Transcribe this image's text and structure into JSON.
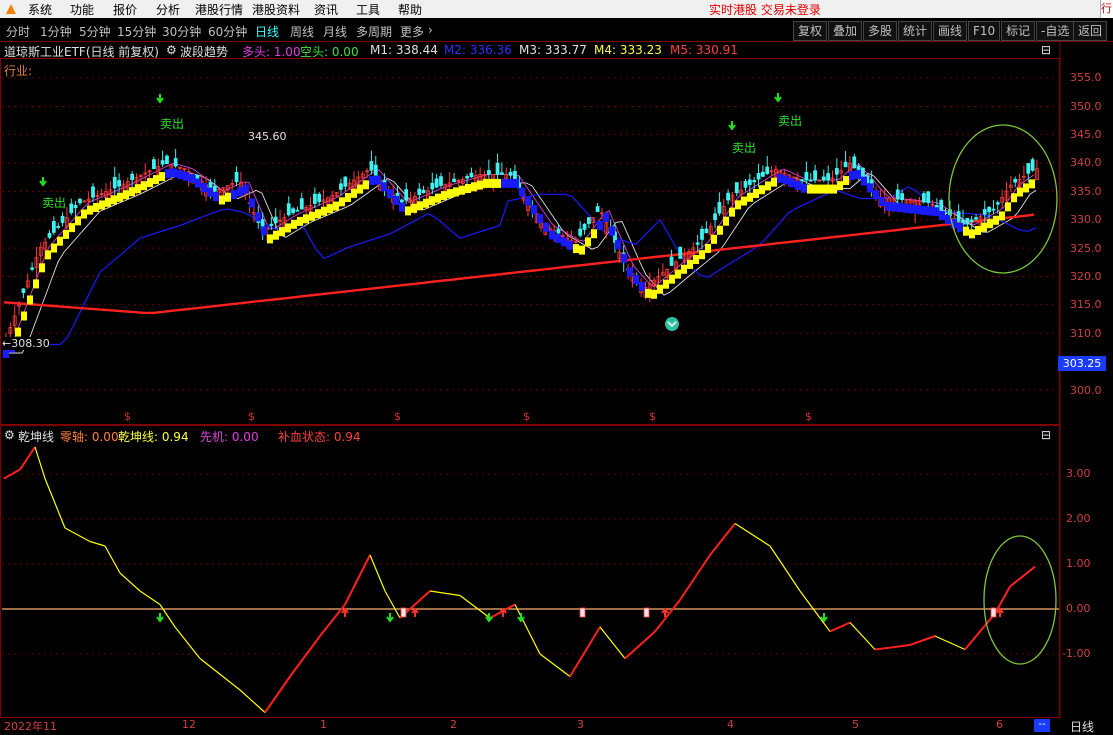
{
  "menu": {
    "items": [
      "系统",
      "功能",
      "报价",
      "分析",
      "港股行情",
      "港股资料",
      "资讯",
      "工具",
      "帮助"
    ],
    "status": "实时港股 交易未登录",
    "edge": "行"
  },
  "tabs": {
    "items": [
      "分时",
      "1分钟",
      "5分钟",
      "15分钟",
      "30分钟",
      "60分钟",
      "日线",
      "周线",
      "月线",
      "多周期",
      "更多"
    ],
    "active": "日线",
    "more_arrow": "›"
  },
  "right_buttons": [
    "复权",
    "叠加",
    "多股",
    "统计",
    "画线",
    "F10",
    "标记",
    "-自选",
    "返回"
  ],
  "info": {
    "title": "道琼斯工业ETF(日线 前复权)",
    "indicator": "波段趋势",
    "duotou": "多头: 1.00",
    "kongtou": "空头: 0.00",
    "m1": "M1: 338.44",
    "m2": "M2: 336.36",
    "m3": "M3: 333.77",
    "m4": "M4: 333.23",
    "m5": "M5: 330.91",
    "industry": "行业:"
  },
  "indicator2": {
    "name": "乾坤线",
    "zero": "零轴: 0.00",
    "qk": "乾坤线: 0.94",
    "xianji": "先机: 0.00",
    "bx": "补血状态: 0.94"
  },
  "price_axis": {
    "ticks": [
      "355.0",
      "350.0",
      "345.0",
      "340.0",
      "335.0",
      "330.0",
      "325.0",
      "320.0",
      "315.0",
      "310.0",
      "305.0",
      "300.0"
    ],
    "current": "303.25"
  },
  "osc_axis": {
    "ticks": [
      "3.00",
      "2.00",
      "1.00",
      "0.00",
      "-1.00"
    ]
  },
  "annotations": {
    "high": "345.60",
    "low": "308.30",
    "sell": "卖出",
    "dollar": "$"
  },
  "date_axis": {
    "labels": [
      "2022年11",
      "12",
      "1",
      "2",
      "3",
      "4",
      "5",
      "6"
    ],
    "mode": "日线",
    "dash": "--"
  },
  "colors": {
    "up": "#ff3a3a",
    "down": "#3ff0f0",
    "ma_yellow": "#ffff00",
    "ma_blue": "#1a1aff",
    "ma_red": "#ff2020",
    "grid": "#6a0000"
  }
}
